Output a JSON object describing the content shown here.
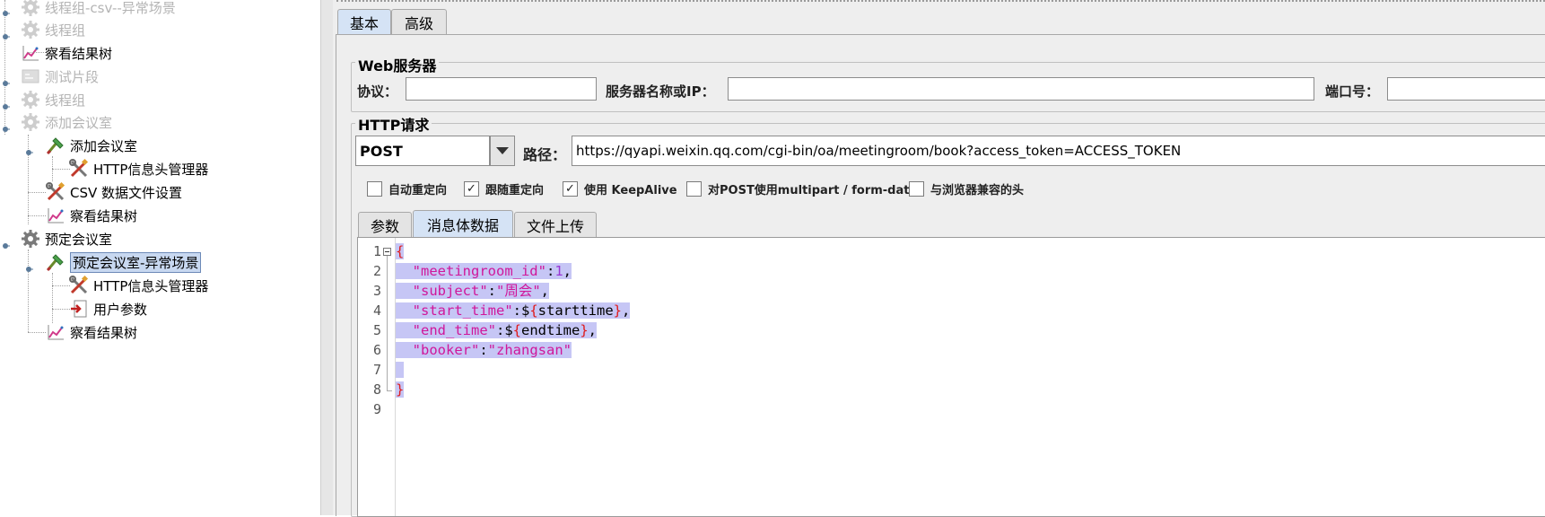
{
  "tree": {
    "items": [
      {
        "label": "线程组-csv--异常场景",
        "icon": "gear-icon",
        "disabled": true
      },
      {
        "label": "线程组",
        "icon": "gear-icon",
        "disabled": true
      },
      {
        "label": "察看结果树",
        "icon": "chart-icon",
        "disabled": false
      },
      {
        "label": "测试片段",
        "icon": "fragment-icon",
        "disabled": true
      },
      {
        "label": "线程组",
        "icon": "gear-icon",
        "disabled": true
      },
      {
        "label": "添加会议室",
        "icon": "gear-icon",
        "disabled": true
      },
      {
        "label": "添加会议室",
        "icon": "sampler-icon",
        "disabled": false
      },
      {
        "label": "HTTP信息头管理器",
        "icon": "tools-icon",
        "disabled": false
      },
      {
        "label": "CSV 数据文件设置",
        "icon": "tools-icon",
        "disabled": false
      },
      {
        "label": "察看结果树",
        "icon": "chart-icon",
        "disabled": false
      },
      {
        "label": "预定会议室",
        "icon": "gear-icon",
        "disabled": false
      },
      {
        "label": "预定会议室-异常场景",
        "icon": "sampler-icon",
        "disabled": false,
        "selected": true
      },
      {
        "label": "HTTP信息头管理器",
        "icon": "tools-icon",
        "disabled": false
      },
      {
        "label": "用户参数",
        "icon": "doc-icon",
        "disabled": false
      },
      {
        "label": "察看结果树",
        "icon": "chart-icon",
        "disabled": false
      }
    ]
  },
  "tabs": {
    "basic": "基本",
    "advanced": "高级"
  },
  "web_server": {
    "legend": "Web服务器",
    "protocol_label": "协议：",
    "protocol_value": "",
    "server_label": "服务器名称或IP：",
    "server_value": "",
    "port_label": "端口号：",
    "port_value": ""
  },
  "http_request": {
    "legend": "HTTP请求",
    "method": "POST",
    "path_label": "路径：",
    "path_value": "https://qyapi.weixin.qq.com/cgi-bin/oa/meetingroom/book?access_token=ACCESS_TOKEN",
    "checkboxes": [
      {
        "label": "自动重定向",
        "checked": false
      },
      {
        "label": "跟随重定向",
        "checked": true
      },
      {
        "label": "使用 KeepAlive",
        "checked": true
      },
      {
        "label": "对POST使用multipart / form-data",
        "checked": false
      },
      {
        "label": "与浏览器兼容的头",
        "checked": false
      }
    ],
    "subtabs": {
      "params": "参数",
      "body": "消息体数据",
      "files": "文件上传"
    }
  },
  "editor": {
    "line_numbers": [
      "1",
      "2",
      "3",
      "4",
      "5",
      "6",
      "7",
      "8",
      "9"
    ],
    "lines": [
      [
        {
          "t": "{",
          "c": "b"
        }
      ],
      [
        {
          "t": "  \"meetingroom_id\"",
          "c": "k"
        },
        {
          "t": ":",
          "c": "p"
        },
        {
          "t": "1",
          "c": "n"
        },
        {
          "t": ",",
          "c": "p"
        }
      ],
      [
        {
          "t": "  \"subject\"",
          "c": "k"
        },
        {
          "t": ":",
          "c": "p"
        },
        {
          "t": "\"周会\"",
          "c": "k"
        },
        {
          "t": ",",
          "c": "p"
        }
      ],
      [
        {
          "t": "  \"start_time\"",
          "c": "k"
        },
        {
          "t": ":$",
          "c": "p"
        },
        {
          "t": "{",
          "c": "b"
        },
        {
          "t": "starttime",
          "c": "p"
        },
        {
          "t": "}",
          "c": "b"
        },
        {
          "t": ",",
          "c": "p"
        }
      ],
      [
        {
          "t": "  \"end_time\"",
          "c": "k"
        },
        {
          "t": ":$",
          "c": "p"
        },
        {
          "t": "{",
          "c": "b"
        },
        {
          "t": "endtime",
          "c": "p"
        },
        {
          "t": "}",
          "c": "b"
        },
        {
          "t": ",",
          "c": "p"
        }
      ],
      [
        {
          "t": "  \"booker\"",
          "c": "k"
        },
        {
          "t": ":",
          "c": "p"
        },
        {
          "t": "\"zhangsan\"",
          "c": "k"
        }
      ],
      [],
      [
        {
          "t": "}",
          "c": "b"
        }
      ],
      []
    ]
  },
  "colors": {
    "selection": "#c6c6f5",
    "key": "#d0179b",
    "number": "#9a36d4",
    "brace": "#e01a1a"
  }
}
